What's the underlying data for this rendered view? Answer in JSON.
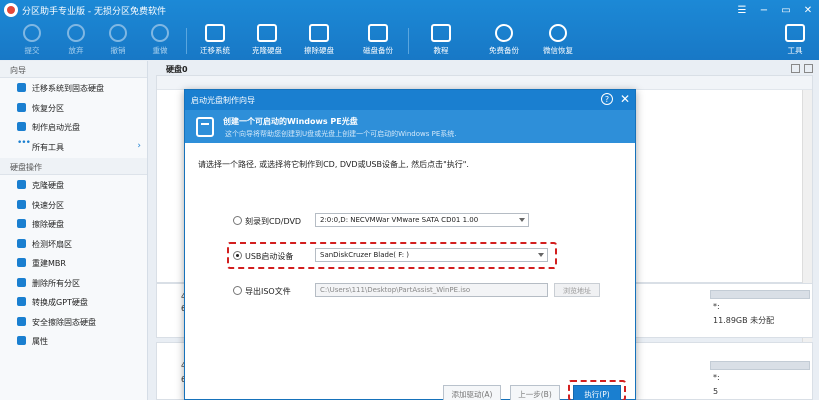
{
  "app": {
    "title": "分区助手专业版 - 无损分区免费软件"
  },
  "toolbar": {
    "items": [
      {
        "label": "提交",
        "icon": "submit-icon",
        "enabled": false
      },
      {
        "label": "放弃",
        "icon": "discard-icon",
        "enabled": false
      },
      {
        "label": "撤销",
        "icon": "undo-icon",
        "enabled": false
      },
      {
        "label": "重做",
        "icon": "redo-icon",
        "enabled": false
      },
      {
        "label": "迁移系统",
        "icon": "migrate-os-icon",
        "enabled": true
      },
      {
        "label": "克隆硬盘",
        "icon": "clone-disk-icon",
        "enabled": true
      },
      {
        "label": "擦除硬盘",
        "icon": "wipe-disk-icon",
        "enabled": true
      },
      {
        "label": "磁盘备份",
        "icon": "disk-backup-icon",
        "enabled": true
      },
      {
        "label": "教程",
        "icon": "tutorial-icon",
        "enabled": true
      },
      {
        "label": "免费备份",
        "icon": "free-backup-icon",
        "enabled": true
      },
      {
        "label": "微信恢复",
        "icon": "wechat-recovery-icon",
        "enabled": true
      },
      {
        "label": "工具",
        "icon": "tools-icon",
        "enabled": true
      }
    ]
  },
  "sidebar": {
    "wizard_header": "向导",
    "wizard_items": [
      {
        "label": "迁移系统到固态硬盘",
        "icon": "migrate-icon"
      },
      {
        "label": "恢复分区",
        "icon": "recover-icon"
      },
      {
        "label": "制作启动光盘",
        "icon": "bootdisk-icon"
      },
      {
        "label": "所有工具",
        "icon": "more-dots-icon"
      }
    ],
    "disk_header": "硬盘操作",
    "disk_items": [
      {
        "label": "克隆硬盘",
        "icon": "clone-icon"
      },
      {
        "label": "快速分区",
        "icon": "lightning-icon"
      },
      {
        "label": "擦除硬盘",
        "icon": "eraser-icon"
      },
      {
        "label": "检测坏扇区",
        "icon": "check-icon"
      },
      {
        "label": "重建MBR",
        "icon": "rebuild-icon"
      },
      {
        "label": "删除所有分区",
        "icon": "delete-icon"
      },
      {
        "label": "转换成GPT硬盘",
        "icon": "convert-icon"
      },
      {
        "label": "安全擦除固态硬盘",
        "icon": "ssd-erase-icon"
      },
      {
        "label": "属性",
        "icon": "properties-icon"
      }
    ]
  },
  "main": {
    "disk_title": "硬盘0",
    "fragments": {
      "left_a": "4",
      "left_b": "6",
      "left_c": "4",
      "left_d": "6",
      "right_a": "*:",
      "right_b": "11.89GB 未分配",
      "right_c": "*:",
      "right_d": "5"
    }
  },
  "dialog": {
    "title": "启动光盘制作向导",
    "help_glyph": "?",
    "close_glyph": "✕",
    "banner_title": "创建一个可启动的Windows PE光盘",
    "banner_subtitle": "这个向导将帮助您创建到U盘或光盘上创建一个可启动的Windows PE系统.",
    "instruction": "请选择一个路径, 或选择将它制作到CD, DVD或USB设备上, 然后点击\"执行\".",
    "options": [
      {
        "label": "刻录到CD/DVD",
        "value": "2:0:0,D: NECVMWar VMware SATA CD01 1.00",
        "checked": false
      },
      {
        "label": "USB启动设备",
        "value": "SanDiskCruzer Blade( F: )",
        "checked": true
      },
      {
        "label": "导出ISO文件",
        "value": "C:\\Users\\111\\Desktop\\PartAssist_WinPE.iso",
        "checked": false
      }
    ],
    "browse_label": "浏览地址",
    "buttons": {
      "add_driver": "添加驱动(A)",
      "back": "上一步(B)",
      "execute": "执行(P)"
    }
  },
  "colors": {
    "accent": "#1a7fd0",
    "highlight": "#d21f1f"
  }
}
